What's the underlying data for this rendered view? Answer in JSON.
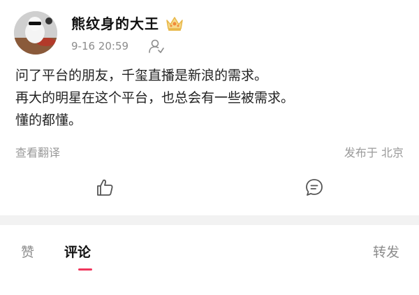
{
  "post": {
    "author": "熊纹身的大王",
    "time": "9-16 20:59",
    "lines": [
      "问了平台的朋友，千玺直播是新浪的需求。",
      "再大的明星在这个平台，也总会有一些被需求。",
      "懂的都懂。"
    ],
    "translate_label": "查看翻译",
    "location_label": "发布于 北京"
  },
  "actions": {
    "like_icon": "thumbs-up-icon",
    "comment_icon": "comment-icon"
  },
  "tabs": {
    "like": "赞",
    "comment": "评论",
    "repost": "转发"
  },
  "colors": {
    "accent": "#f0365c",
    "meta_text": "#8c8c8c",
    "crown": "#e8b84a"
  }
}
